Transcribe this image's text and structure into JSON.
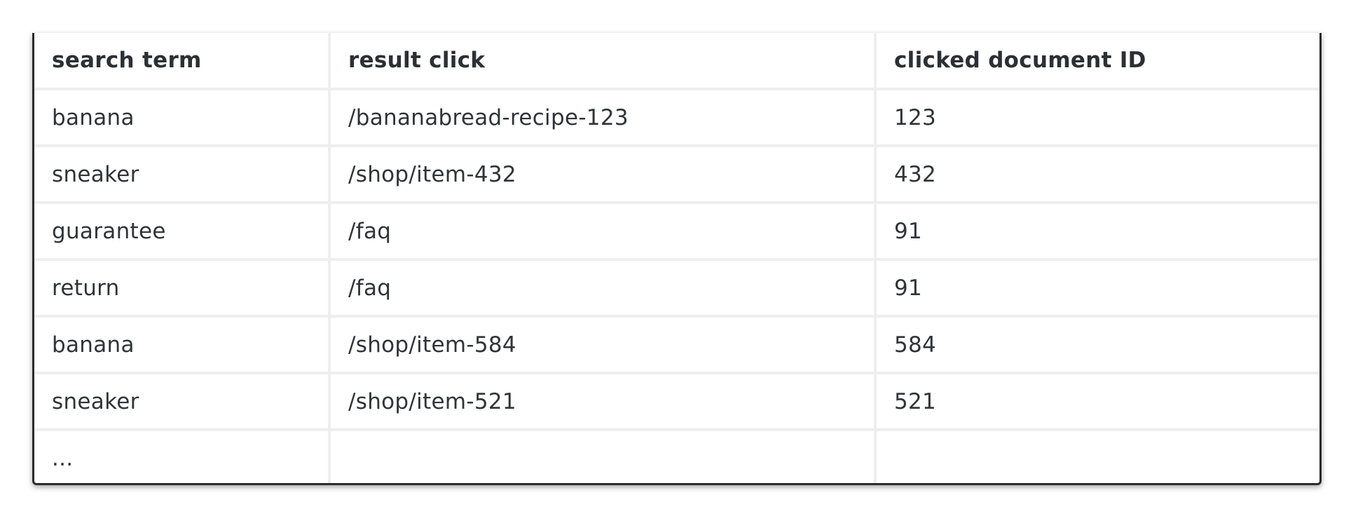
{
  "table": {
    "headers": [
      "search term",
      "result click",
      "clicked document ID"
    ],
    "rows": [
      [
        "banana",
        "/bananabread-recipe-123",
        "123"
      ],
      [
        "sneaker",
        "/shop/item-432",
        "432"
      ],
      [
        "guarantee",
        "/faq",
        "91"
      ],
      [
        "return",
        "/faq",
        "91"
      ],
      [
        "banana",
        "/shop/item-584",
        "584"
      ],
      [
        "sneaker",
        "/shop/item-521",
        "521"
      ],
      [
        "...",
        "",
        ""
      ]
    ]
  }
}
